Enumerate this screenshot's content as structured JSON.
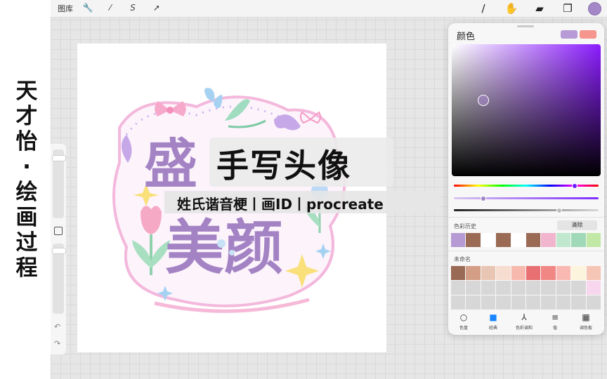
{
  "side_title": [
    "天",
    "才",
    "怡",
    "·",
    "绘",
    "画",
    "过",
    "程"
  ],
  "toolbar": {
    "gallery": "图库",
    "left_tools": [
      {
        "icon": "wrench-icon",
        "glyph": "🔧"
      },
      {
        "icon": "magic-wand-icon",
        "glyph": "⁄"
      },
      {
        "icon": "selection-icon",
        "glyph": "S"
      },
      {
        "icon": "transform-icon",
        "glyph": "➚"
      }
    ],
    "right_tools": [
      {
        "icon": "brush-icon",
        "glyph": "/"
      },
      {
        "icon": "smudge-icon",
        "glyph": "✋"
      },
      {
        "icon": "eraser-icon",
        "glyph": "▰"
      },
      {
        "icon": "layers-icon",
        "glyph": "❐"
      }
    ],
    "active_color": "#a487c7"
  },
  "banner": {
    "title": "手写头像",
    "subtitle": "姓氏谐音梗丨画ID丨procreate"
  },
  "artwork": {
    "line1": "盛",
    "line2": "美颜"
  },
  "color_panel": {
    "title": "颜色",
    "current_color": "#b79ad6",
    "previous_color": "#f5958d",
    "history_label": "色彩历史",
    "clear_label": "清除",
    "history": [
      "#b59ad4",
      "#9a6a55",
      "#ffffff",
      "#9a6a55",
      "#ffffff",
      "#9a6a55",
      "#f1b5cd",
      "#bfe8cf",
      "#9fd9b8",
      "#c2e8a6"
    ],
    "palette_label": "未命名",
    "palette": [
      "#9a6a55",
      "#d39e85",
      "#e8c6b3",
      "#f6ddd0",
      "#f7b8ad",
      "#e86f72",
      "#f08784",
      "#f9b9b2",
      "#fcf4dd",
      "#f6c5b6",
      "#d7d7d7",
      "#d7d7d7",
      "#d7d7d7",
      "#d7d7d7",
      "#d7d7d7",
      "#d7d7d7",
      "#d7d7d7",
      "#d7d7d7",
      "#d7d7d7",
      "#f8d7ee",
      "#d7d7d7",
      "#d7d7d7",
      "#d7d7d7",
      "#d7d7d7",
      "#d7d7d7",
      "#d7d7d7",
      "#d7d7d7",
      "#d7d7d7",
      "#d7d7d7",
      "#d7d7d7"
    ],
    "tabs": [
      {
        "label": "色盘",
        "icon": "disc-icon",
        "glyph": "○"
      },
      {
        "label": "经典",
        "icon": "classic-icon",
        "glyph": "■",
        "active": true
      },
      {
        "label": "色彩调和",
        "icon": "harmony-icon",
        "glyph": "⅄"
      },
      {
        "label": "值",
        "icon": "value-icon",
        "glyph": "≡"
      },
      {
        "label": "调色板",
        "icon": "palettes-icon",
        "glyph": "▦"
      }
    ]
  }
}
